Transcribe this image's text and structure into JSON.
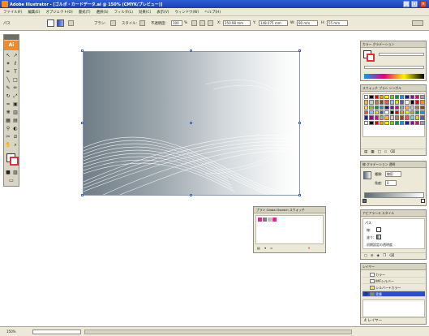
{
  "window": {
    "title": "Adobe Illustrator - [ゴルポ・カードデータ.ai @ 150% (CMYK/プレビュー)]"
  },
  "menu": {
    "items": [
      "ファイル(F)",
      "編集(E)",
      "オブジェクト(O)",
      "書式(T)",
      "選択(S)",
      "フィルタ(L)",
      "効果(C)",
      "表示(V)",
      "ウィンドウ(W)",
      "ヘルプ(H)"
    ]
  },
  "control_bar": {
    "object_label": "パス",
    "stroke_label": "ブラシ:",
    "style_label": "スタイル:",
    "opacity_label": "不透明度:",
    "opacity_value": "100",
    "opacity_unit": "%",
    "x_label": "X:",
    "x_value": "250.98 mm",
    "y_label": "Y:",
    "y_value": "148.075 mm",
    "w_label": "W:",
    "w_value": "90 mm",
    "h_label": "H:",
    "h_value": "55 mm"
  },
  "floating_panel": {
    "tabs": "ブラシ  Global Swatch  スウォッチ"
  },
  "panels": {
    "color": {
      "tabs": "カラー  グラデーション"
    },
    "swatches": {
      "tabs": "スウォッチ  ブラシ  シンボル"
    },
    "gradient": {
      "tabs": "線  グラデーション  透明",
      "type_label": "種類:",
      "type_value": "線形",
      "angle_label": "角度:",
      "angle_value": "0"
    },
    "appearance": {
      "tabs": "アピアランス  スタイル",
      "path_label": "パス",
      "stroke_label": "線:",
      "fill_label": "塗り:",
      "opacity_label": "初期設定の透明度"
    },
    "layers": {
      "tabs": "レイヤー",
      "items": [
        {
          "name": "カラー"
        },
        {
          "name": "IMFシルバー"
        },
        {
          "name": "シルバー+カラー"
        },
        {
          "name": "背景"
        }
      ]
    }
  },
  "status_bar": {
    "zoom": "150%",
    "layer_count": "4 レイヤー"
  },
  "colors": {
    "accent": "#2d4ec8",
    "titlebar": "#1c3fb0",
    "chrome": "#ece9d8"
  }
}
